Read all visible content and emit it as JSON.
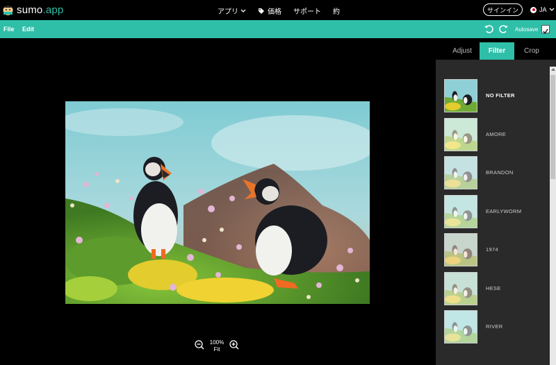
{
  "brand": {
    "name": "sumo",
    "suffix": ".app",
    "accent": "#2fbfa8"
  },
  "nav": {
    "apps": "アプリ",
    "pricing": "価格",
    "support": "サポート",
    "about": "約",
    "signin": "サインイン",
    "lang": "JA"
  },
  "toolbar": {
    "file": "File",
    "edit": "Edit",
    "autosave": "Autosave",
    "autosave_checked": true,
    "icons": [
      "undo-icon",
      "redo-icon"
    ]
  },
  "zoom": {
    "level": "100%",
    "fit": "Fit"
  },
  "tabs": [
    {
      "label": "Adjust",
      "active": false
    },
    {
      "label": "Filter",
      "active": true
    },
    {
      "label": "Crop",
      "active": false
    }
  ],
  "filters": [
    {
      "label": "NO FILTER",
      "selected": true,
      "tint": "none"
    },
    {
      "label": "AMORE",
      "selected": false,
      "tint": "#fffbd8"
    },
    {
      "label": "BRANDON",
      "selected": false,
      "tint": "#f3f0ee"
    },
    {
      "label": "EARLYWORM",
      "selected": false,
      "tint": "#eef7ee"
    },
    {
      "label": "1974",
      "selected": false,
      "tint": "#f6d8c4"
    },
    {
      "label": "HESE",
      "selected": false,
      "tint": "#f7efd8"
    },
    {
      "label": "RIVER",
      "selected": false,
      "tint": "#e9f7f3"
    }
  ]
}
